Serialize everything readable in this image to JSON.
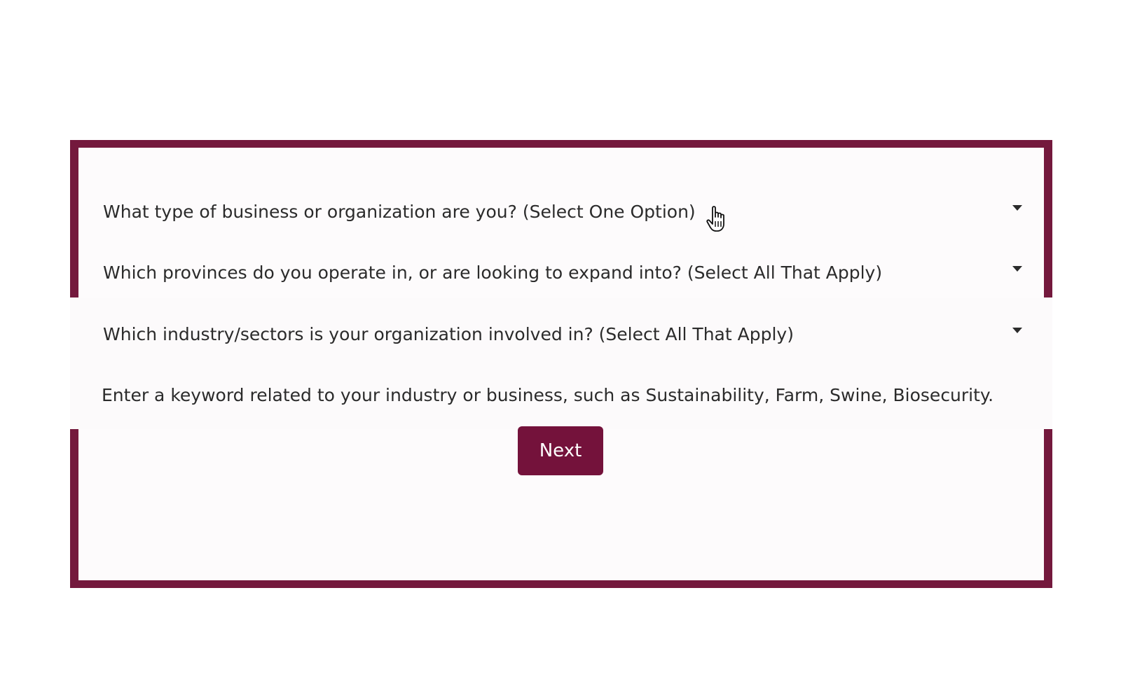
{
  "form": {
    "questions": [
      {
        "label": "What type of business or organization are you? (Select One Option)",
        "icon": "chevron-down-icon"
      },
      {
        "label": "Which provinces do you operate in, or are looking to expand into? (Select All That Apply)",
        "icon": "chevron-down-icon"
      },
      {
        "label": "Which industry/sectors is your organization involved in? (Select All That Apply)",
        "icon": "chevron-down-icon"
      }
    ],
    "keyword_placeholder": "Enter a keyword related to your industry or business, such as Sustainability, Farm, Swine, Biosecurity.",
    "next_label": "Next"
  },
  "colors": {
    "frame": "#74193d",
    "button": "#74123b",
    "button_text": "#ffffff",
    "text": "#2b2b2b"
  },
  "pointer": {
    "icon": "hand-pointer-icon"
  }
}
